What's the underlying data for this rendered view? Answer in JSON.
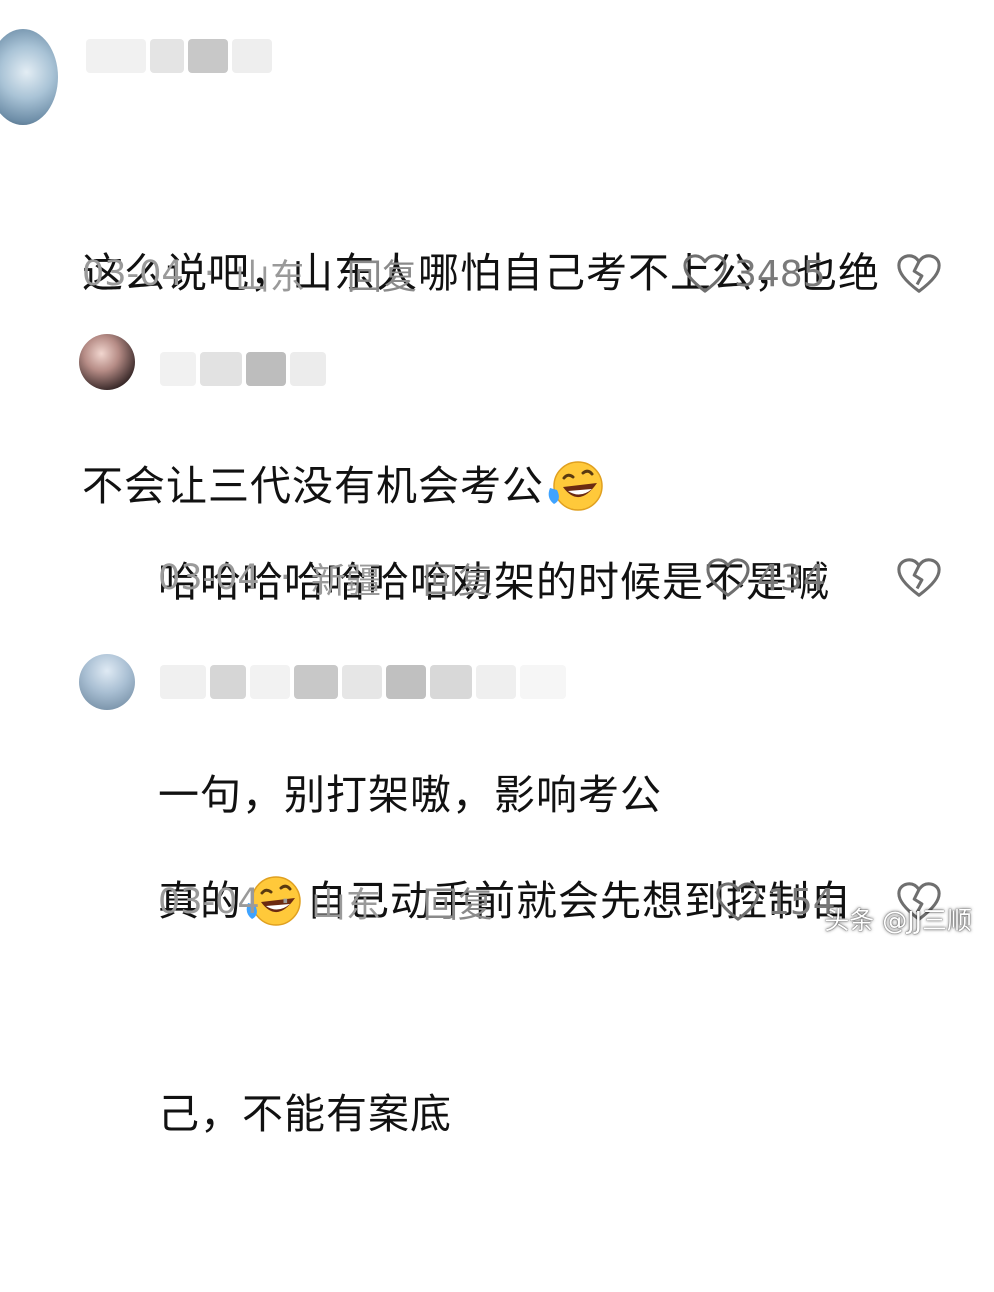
{
  "comments": [
    {
      "text_line1": "这么说吧，山东人哪怕自己考不上公，也绝",
      "text_line2": "不会让三代没有机会考公",
      "date": "03-04",
      "location": "山东",
      "reply_label": "回复",
      "likes": "3485"
    },
    {
      "text_line1": "哈哈哈哈哈哈哈劝架的时候是不是喊",
      "text_line2": "一句，别打架嗷，影响考公",
      "date": "03-04",
      "location": "新疆",
      "reply_label": "回复",
      "likes": "434"
    },
    {
      "text_line1_a": "真的",
      "text_line1_b": "自己动手前就会先想到控制自",
      "text_line2": "己，不能有案底",
      "date": "03-04",
      "location": "山东",
      "reply_label": "回复",
      "likes": "154"
    }
  ],
  "separator": "·",
  "emoji_name": "rolling-on-floor-laughing-icon",
  "watermark": "头条 @JJ三顺",
  "colors": {
    "meta": "#9a9a9a",
    "text": "#111111",
    "icon": "#7a7a7a"
  }
}
